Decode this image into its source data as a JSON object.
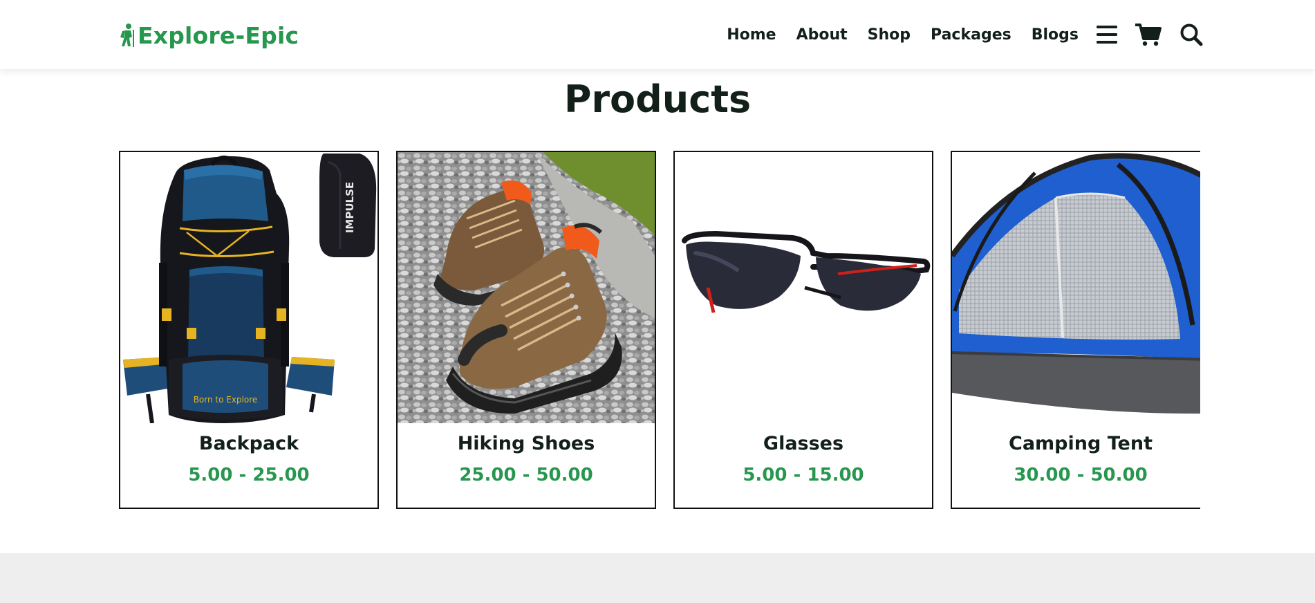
{
  "brand": {
    "name": "Explore-Epic",
    "color": "#27964f"
  },
  "nav": {
    "items": [
      {
        "label": "Home"
      },
      {
        "label": "About"
      },
      {
        "label": "Shop"
      },
      {
        "label": "Packages"
      },
      {
        "label": "Blogs"
      }
    ],
    "icons": [
      "menu-icon",
      "cart-icon",
      "search-icon"
    ]
  },
  "products_section": {
    "title": "Products",
    "items": [
      {
        "name": "Backpack",
        "price": "5.00 - 25.00",
        "image": "backpack"
      },
      {
        "name": "Hiking Shoes",
        "price": "25.00 - 50.00",
        "image": "hiking-shoes"
      },
      {
        "name": "Glasses",
        "price": "5.00 - 15.00",
        "image": "sunglasses"
      },
      {
        "name": "Camping Tent",
        "price": "30.00 - 50.00",
        "image": "tent"
      }
    ]
  },
  "images": {
    "backpack_brand_text": "Born to Explore",
    "daypack_text": "IMPULSE"
  }
}
